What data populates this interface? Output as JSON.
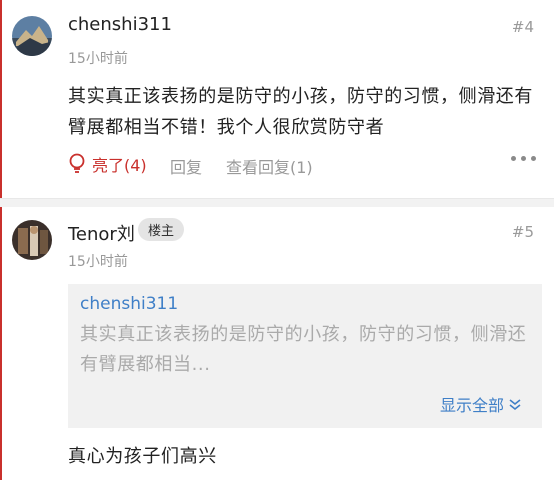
{
  "posts": [
    {
      "username": "chenshi311",
      "time": "15小时前",
      "floor": "#4",
      "content": "其实真正该表扬的是防守的小孩，防守的习惯，侧滑还有臂展都相当不错！我个人很欣赏防守者",
      "like_label": "亮了(4)",
      "reply_label": "回复",
      "view_replies_label": "查看回复(1)"
    },
    {
      "username": "Tenor刘",
      "badge": "楼主",
      "time": "15小时前",
      "floor": "#5",
      "quote": {
        "username": "chenshi311",
        "text": "其实真正该表扬的是防守的小孩，防守的习惯，侧滑还有臂展都相当...",
        "show_all_label": "显示全部"
      },
      "content": "真心为孩子们高兴"
    }
  ],
  "colors": {
    "accent": "#c9302c",
    "link": "#3f7fc7",
    "muted": "#999999"
  }
}
